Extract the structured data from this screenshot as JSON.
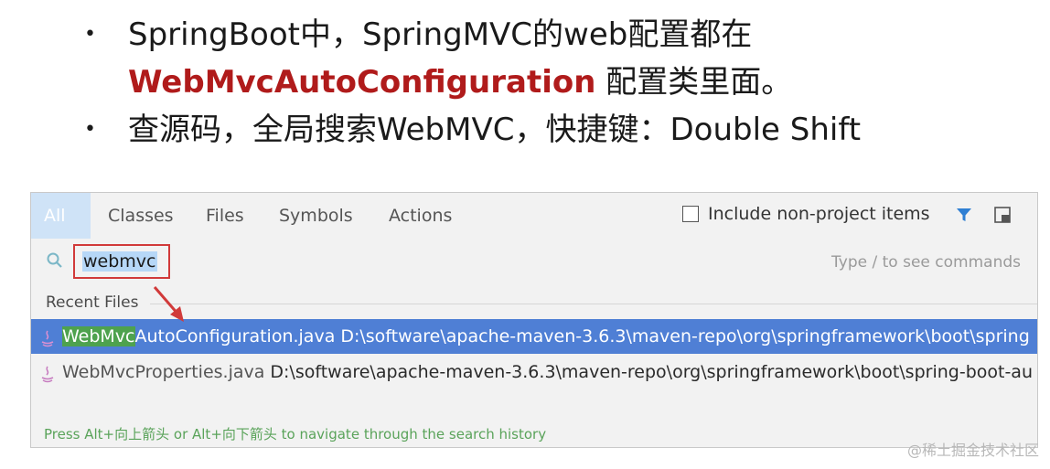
{
  "slide": {
    "bullet_1_line_1": "SpringBoot中，SpringMVC的web配置都在",
    "bullet_1_highlight": "WebMvcAutoConfiguration",
    "bullet_1_line_2_rest": " 配置类里面。",
    "bullet_2": "查源码，全局搜索WebMVC，快捷键：Double Shift",
    "bullet_char": "•"
  },
  "dialog": {
    "tabs": [
      {
        "label": "All",
        "active": true
      },
      {
        "label": "Classes",
        "active": false
      },
      {
        "label": "Files",
        "active": false
      },
      {
        "label": "Symbols",
        "active": false
      },
      {
        "label": "Actions",
        "active": false
      }
    ],
    "include_label": "Include non-project items",
    "include_checked": false,
    "search_value": "webmvc",
    "search_hint": "Type / to see commands",
    "section_label": "Recent Files",
    "results": [
      {
        "match": "WebMvc",
        "rest": "AutoConfiguration.java",
        "path": "D:\\software\\apache-maven-3.6.3\\maven-repo\\org\\springframework\\boot\\spring",
        "selected": true,
        "icon": "java-file-icon"
      },
      {
        "match": "",
        "rest": "WebMvcProperties.java",
        "path": "D:\\software\\apache-maven-3.6.3\\maven-repo\\org\\springframework\\boot\\spring-boot-au",
        "selected": false,
        "icon": "java-file-icon"
      }
    ],
    "footer_hint": "Press Alt+向上箭头 or Alt+向下箭头 to navigate through the search history"
  },
  "watermark": "@稀土掘金技术社区",
  "colors": {
    "accent_red": "#b01b1b",
    "selection_blue": "#4f7fd5",
    "match_green": "#4ea24e",
    "tab_active": "#cfe3f7",
    "filter_blue": "#2f7fd3"
  }
}
